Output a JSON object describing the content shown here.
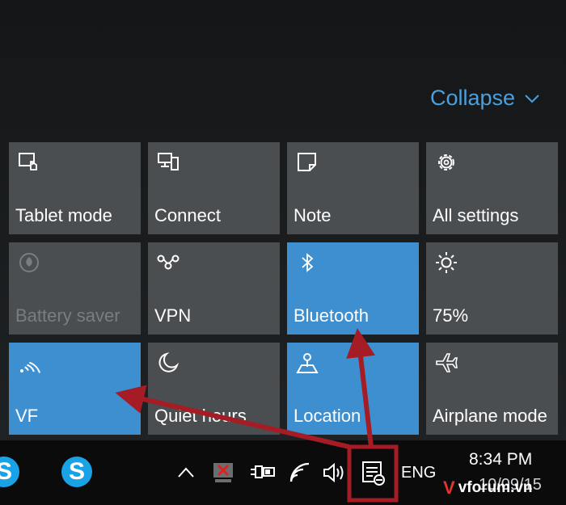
{
  "action_center": {
    "collapse_label": "Collapse",
    "collapse_icon": "chevron-down-icon",
    "tiles": [
      {
        "label": "Tablet mode",
        "icon": "tablet-mode-icon",
        "state": "off"
      },
      {
        "label": "Connect",
        "icon": "connect-icon",
        "state": "off"
      },
      {
        "label": "Note",
        "icon": "note-icon",
        "state": "off"
      },
      {
        "label": "All settings",
        "icon": "gear-icon",
        "state": "off"
      },
      {
        "label": "Battery saver",
        "icon": "battery-saver-icon",
        "state": "disabled"
      },
      {
        "label": "VPN",
        "icon": "vpn-icon",
        "state": "off"
      },
      {
        "label": "Bluetooth",
        "icon": "bluetooth-icon",
        "state": "on"
      },
      {
        "label": "75%",
        "icon": "brightness-icon",
        "state": "off"
      },
      {
        "label": "VF",
        "icon": "wifi-icon",
        "state": "on"
      },
      {
        "label": "Quiet hours",
        "icon": "moon-icon",
        "state": "off"
      },
      {
        "label": "Location",
        "icon": "location-icon",
        "state": "on"
      },
      {
        "label": "Airplane mode",
        "icon": "airplane-icon",
        "state": "off"
      }
    ]
  },
  "taskbar": {
    "apps": [
      {
        "icon": "skype-icon",
        "glyph": "S"
      },
      {
        "icon": "skype-icon",
        "glyph": "S"
      }
    ],
    "tray_icons": [
      "chevron-up-icon",
      "network-disconnected-icon",
      "power-icon",
      "wifi-icon",
      "volume-icon",
      "action-center-icon"
    ],
    "language": "ENG",
    "time": "8:34 PM",
    "date": "10/09/15"
  },
  "watermark": {
    "text": "vforum.vn",
    "mark": "V"
  },
  "colors": {
    "tile_off": "#4b4e51",
    "tile_on": "#3d8fd0",
    "accent": "#4aa0df",
    "annotation": "#a51c24"
  }
}
